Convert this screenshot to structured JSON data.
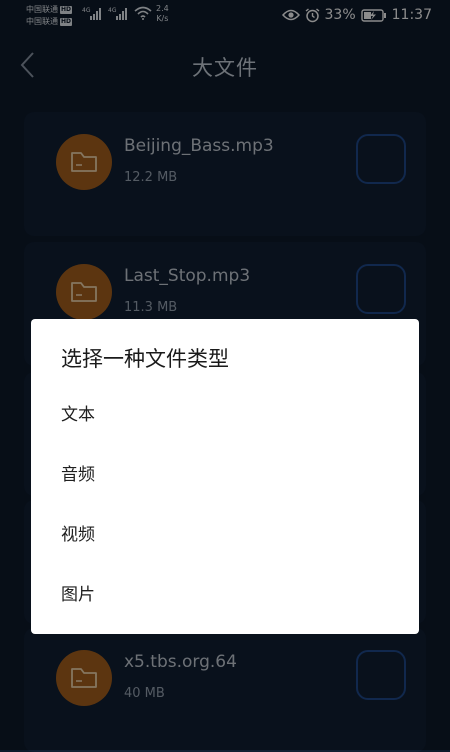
{
  "status_bar": {
    "carrier1": "中国联通",
    "carrier2": "中国联通",
    "hd": "HD",
    "net_type1": "4G",
    "net_type2": "4G",
    "speed_value": "2.4",
    "speed_unit": "K/s",
    "battery": "33%",
    "time": "11:37"
  },
  "header": {
    "title": "大文件"
  },
  "files": [
    {
      "name": "Beijing_Bass.mp3",
      "size": "12.2 MB"
    },
    {
      "name": "Last_Stop.mp3",
      "size": "11.3 MB"
    },
    {
      "name": "x5.tbs.org.64",
      "size": "40 MB"
    }
  ],
  "dialog": {
    "title": "选择一种文件类型",
    "options": [
      "文本",
      "音频",
      "视频",
      "图片"
    ]
  },
  "colors": {
    "background": "#0d1a2b",
    "card": "#111f33",
    "file_icon": "#a8621e",
    "checkbox_border": "#1f4a8c"
  }
}
